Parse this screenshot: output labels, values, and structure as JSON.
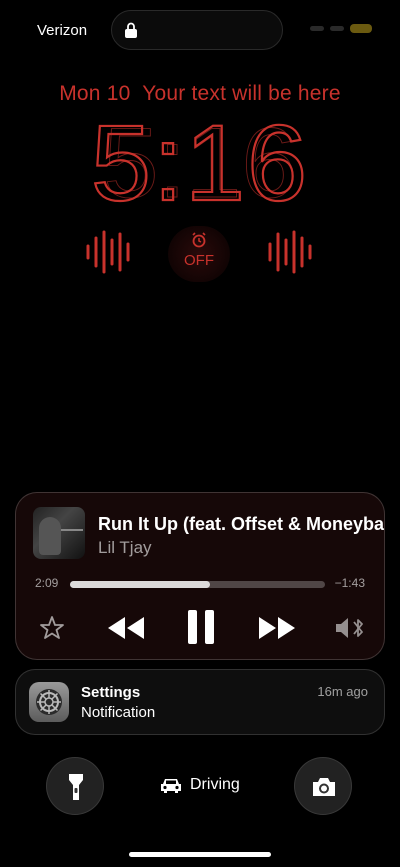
{
  "status_bar": {
    "carrier": "Verizon",
    "lock_icon": "lock-icon",
    "battery_color": "#6b5a10"
  },
  "lock_screen": {
    "date_text": "Mon 10",
    "custom_text": "Your text will be here",
    "time": "5:16",
    "accent_color": "#c8322c"
  },
  "widgets": {
    "alarm_label": "OFF",
    "alarm_icon": "alarm-clock-icon",
    "waveform_icon": "waveform-icon"
  },
  "now_playing": {
    "title": "Run It Up (feat. Offset & Moneybagg Yo)",
    "artist": "Lil Tjay",
    "elapsed": "2:09",
    "remaining": "−1:43",
    "progress": 0.55,
    "controls": [
      "star-icon",
      "rewind-icon",
      "pause-icon",
      "fast-forward-icon",
      "airplay-bluetooth-icon"
    ]
  },
  "notification": {
    "app": "Settings",
    "body": "Notification",
    "time": "16m ago",
    "icon": "settings-gear-icon"
  },
  "bottom": {
    "focus_label": "Driving",
    "focus_icon": "car-icon",
    "left_button_icon": "flashlight-icon",
    "right_button_icon": "camera-icon"
  }
}
